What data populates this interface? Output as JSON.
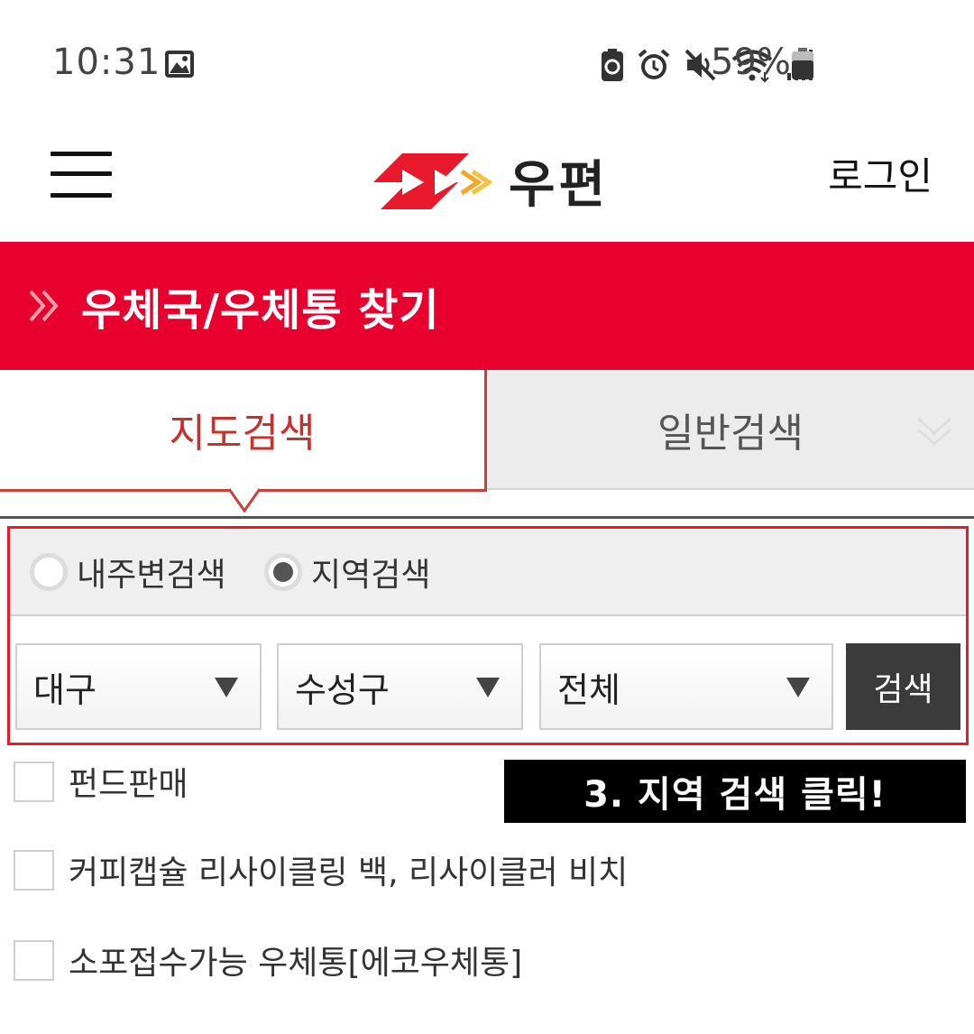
{
  "status_bar": {
    "time": "10:31",
    "battery": "59%",
    "icons": [
      "gallery-icon",
      "battery-saver-icon",
      "alarm-icon",
      "mute-icon",
      "wifi-icon",
      "signal-icon",
      "battery-icon"
    ]
  },
  "header": {
    "logo_text": "우편",
    "login_label": "로그인"
  },
  "banner": {
    "title": "우체국/우체통 찾기"
  },
  "tabs": [
    {
      "label": "지도검색",
      "active": true
    },
    {
      "label": "일반검색",
      "active": false
    }
  ],
  "search": {
    "radio_options": [
      {
        "label": "내주변검색",
        "checked": false
      },
      {
        "label": "지역검색",
        "checked": true
      }
    ],
    "selects": [
      {
        "value": "대구"
      },
      {
        "value": "수성구"
      },
      {
        "value": "전체"
      }
    ],
    "button_label": "검색"
  },
  "filters": [
    {
      "label": "펀드판매",
      "checked": false
    },
    {
      "label": "커피캡슐 리사이클링 백, 리사이클러 비치",
      "checked": false
    },
    {
      "label": "소포접수가능 우체통[에코우체통]",
      "checked": false
    }
  ],
  "annotation": {
    "text": "3. 지역 검색 클릭!"
  },
  "colors": {
    "brand_red": "#e8002e",
    "active_tab_text": "#c9302a",
    "highlight_border": "#e81b2b",
    "search_button": "#3b3b3b"
  }
}
